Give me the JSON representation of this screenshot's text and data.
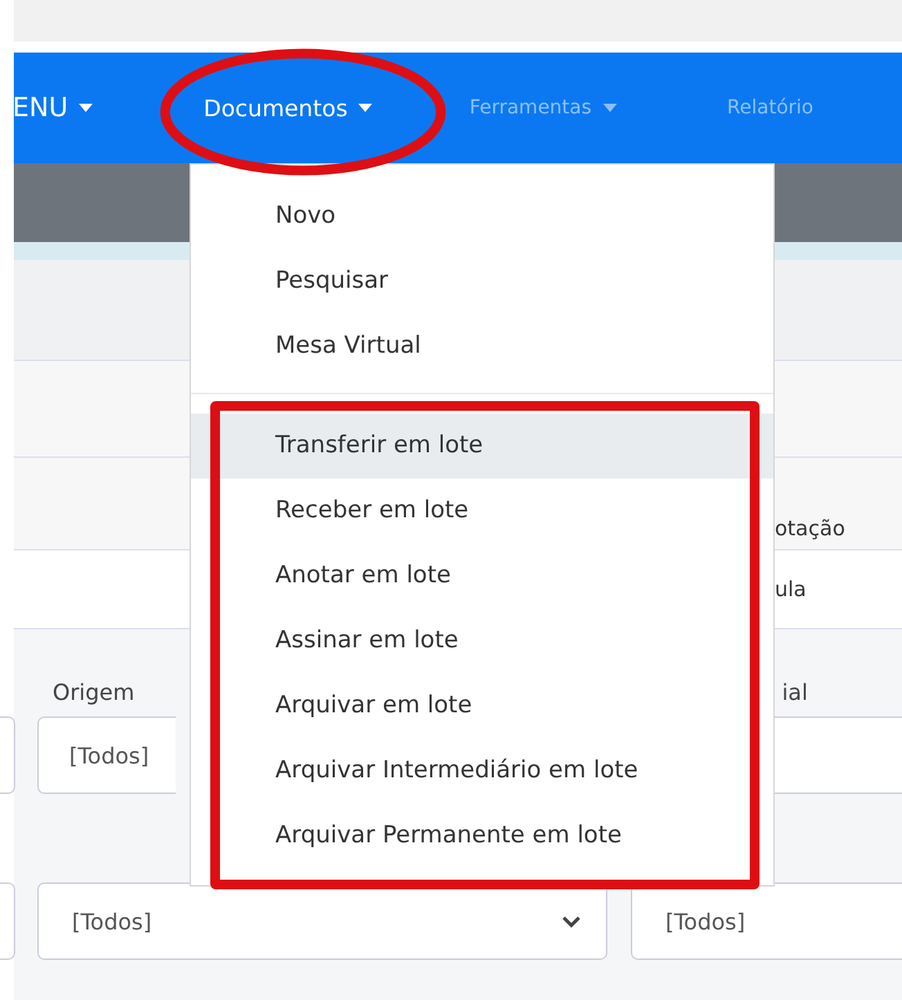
{
  "navbar": {
    "items": [
      {
        "label": "ENU",
        "caret": true,
        "active": true
      },
      {
        "label": "Documentos",
        "caret": true,
        "active": true
      },
      {
        "label": "Ferramentas",
        "caret": true,
        "active": false
      },
      {
        "label": "Relatório",
        "caret": false,
        "active": false
      }
    ]
  },
  "menu": {
    "groups": [
      [
        {
          "label": "Novo",
          "selected": false
        },
        {
          "label": "Pesquisar",
          "selected": false
        },
        {
          "label": "Mesa Virtual",
          "selected": false
        }
      ],
      [
        {
          "label": "Transferir em lote",
          "selected": true
        },
        {
          "label": "Receber em lote",
          "selected": false
        },
        {
          "label": "Anotar em lote",
          "selected": false
        },
        {
          "label": "Assinar em lote",
          "selected": false
        },
        {
          "label": "Arquivar em lote",
          "selected": false
        },
        {
          "label": "Arquivar Intermediário em lote",
          "selected": false
        },
        {
          "label": "Arquivar Permanente em lote",
          "selected": false
        }
      ]
    ]
  },
  "form": {
    "column_heading": "otação",
    "cell_value": "ula",
    "origem": {
      "label": "Origem",
      "value": "[Todos]"
    },
    "right_label": "ial",
    "selects": [
      {
        "value": "[Todos]",
        "chevron": true
      },
      {
        "value": "[Todos]",
        "chevron": false
      }
    ]
  },
  "annotations": [
    {
      "kind": "ellipse"
    },
    {
      "kind": "rectangle"
    }
  ]
}
